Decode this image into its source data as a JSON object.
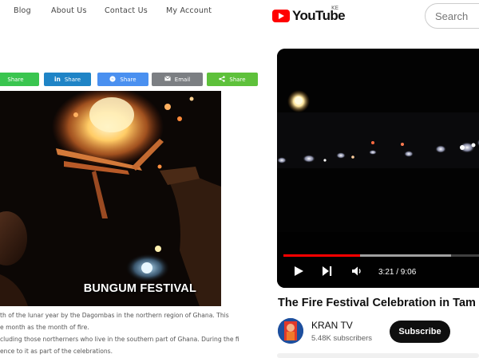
{
  "blog": {
    "nav": [
      "Blog",
      "About Us",
      "Contact Us",
      "My Account"
    ],
    "share_buttons": [
      {
        "label": "Share",
        "icon": "share-icon",
        "color": "#3ac54f"
      },
      {
        "label": "Share",
        "icon": "linkedin-icon",
        "icon_text": "in",
        "color": "#1f84c6"
      },
      {
        "label": "Share",
        "icon": "messenger-icon",
        "color": "#4a90f0"
      },
      {
        "label": "Email",
        "icon": "email-icon",
        "color": "#7c7f83"
      },
      {
        "label": "Share",
        "icon": "sharethis-icon",
        "color": "#5ec13b"
      }
    ],
    "hero_caption": "BUNGUM FESTIVAL",
    "article_lines": [
      "th of the lunar year by the Dagombas in the northern region of Ghana. This",
      "e month as the month of fire.",
      "cluding those northerners who live in the southern part of Ghana. During the fi",
      "ence to it as part of the celebrations."
    ]
  },
  "youtube": {
    "logo_text": "YouTube",
    "region": "KE",
    "search_placeholder": "Search",
    "player": {
      "current_time": "3:21",
      "duration": "9:06",
      "time_display": "3:21 / 9:06",
      "progress_fraction": 0.368,
      "buffered_fraction": 0.8
    },
    "video_title": "The Fire Festival Celebration in Tam",
    "channel": {
      "name": "KRAN TV",
      "subscribers": "5.48K subscribers"
    },
    "subscribe_label": "Subscribe",
    "colors": {
      "brand": "#ff0000",
      "subscribe_bg": "#0f0f0f"
    }
  }
}
